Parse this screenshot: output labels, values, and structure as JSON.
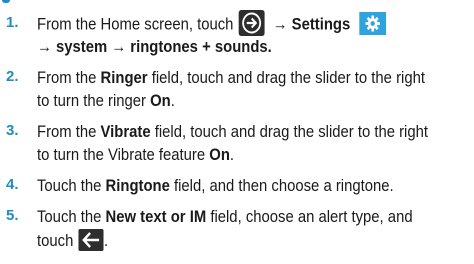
{
  "steps": [
    {
      "number": "1.",
      "line1_prefix": "From the Home screen, touch",
      "arrow1": "→",
      "settings_label": "Settings",
      "line2_arrow1": "→",
      "system_label": "system",
      "line2_arrow2": "→",
      "ringtones_label": "ringtones + sounds",
      "line2_end": "."
    },
    {
      "number": "2.",
      "line1_a": "From the ",
      "field_name": "Ringer",
      "line1_b": " field, touch and drag the slider to the right",
      "line2_a": "to turn the ringer ",
      "state": "On",
      "line2_end": "."
    },
    {
      "number": "3.",
      "line1_a": "From the ",
      "field_name": "Vibrate",
      "line1_b": " field, touch and drag the slider to the right",
      "line2_a": "to turn the Vibrate feature ",
      "state": "On",
      "line2_end": "."
    },
    {
      "number": "4.",
      "line1_a": "Touch the ",
      "field_name": "Ringtone",
      "line1_b": " field, and then choose a ringtone."
    },
    {
      "number": "5.",
      "line1_a": "Touch the ",
      "field_name": "New text or IM",
      "line1_b": " field, choose an alert type, and",
      "line2_a": "touch",
      "line2_end": "."
    }
  ],
  "icons": {
    "home_arrow": "circle-arrow-right-icon",
    "settings": "gear-icon",
    "back": "back-arrow-icon"
  },
  "colors": {
    "accent": "#1d8cc9",
    "text": "#1a1a1a",
    "icon_dark": "#2e2e2e",
    "icon_blue": "#2fa3dd"
  }
}
